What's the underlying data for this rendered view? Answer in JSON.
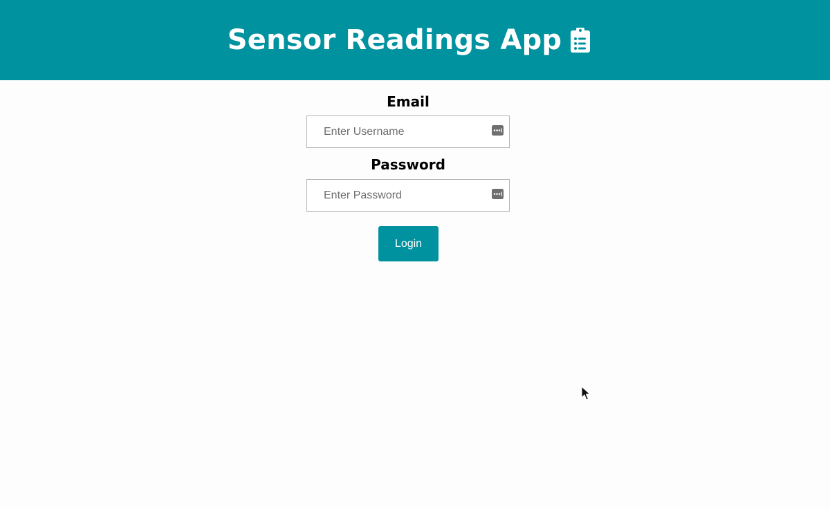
{
  "header": {
    "title": "Sensor Readings App",
    "icon": "clipboard-list-icon",
    "background": "#00929f"
  },
  "form": {
    "email": {
      "label": "Email",
      "placeholder": "Enter Username",
      "value": ""
    },
    "password": {
      "label": "Password",
      "placeholder": "Enter Password",
      "value": ""
    },
    "login_label": "Login"
  },
  "colors": {
    "accent": "#00929f",
    "page_background": "#fdfdfd",
    "input_border": "#b4b4b4"
  }
}
